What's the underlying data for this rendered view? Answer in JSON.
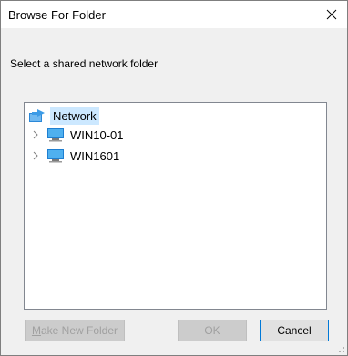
{
  "window": {
    "title": "Browse For Folder"
  },
  "instruction": "Select a shared network folder",
  "tree": {
    "root": {
      "label": "Network",
      "icon": "network-icon",
      "selected": true
    },
    "children": [
      {
        "label": "WIN10-01",
        "icon": "computer-icon",
        "expander": "chevron-right-icon"
      },
      {
        "label": "WIN1601",
        "icon": "computer-icon",
        "expander": "chevron-right-icon"
      }
    ]
  },
  "buttons": {
    "make_new_folder": {
      "label": "Make New Folder",
      "mnemonic": "M",
      "rest": "ake New Folder",
      "enabled": false
    },
    "ok": {
      "label": "OK",
      "enabled": false
    },
    "cancel": {
      "label": "Cancel",
      "enabled": true
    }
  },
  "colors": {
    "selection": "#cce8ff",
    "accent": "#0078d7",
    "dialog_bg": "#f0f0f0",
    "disabled_text": "#a0a0a0"
  }
}
